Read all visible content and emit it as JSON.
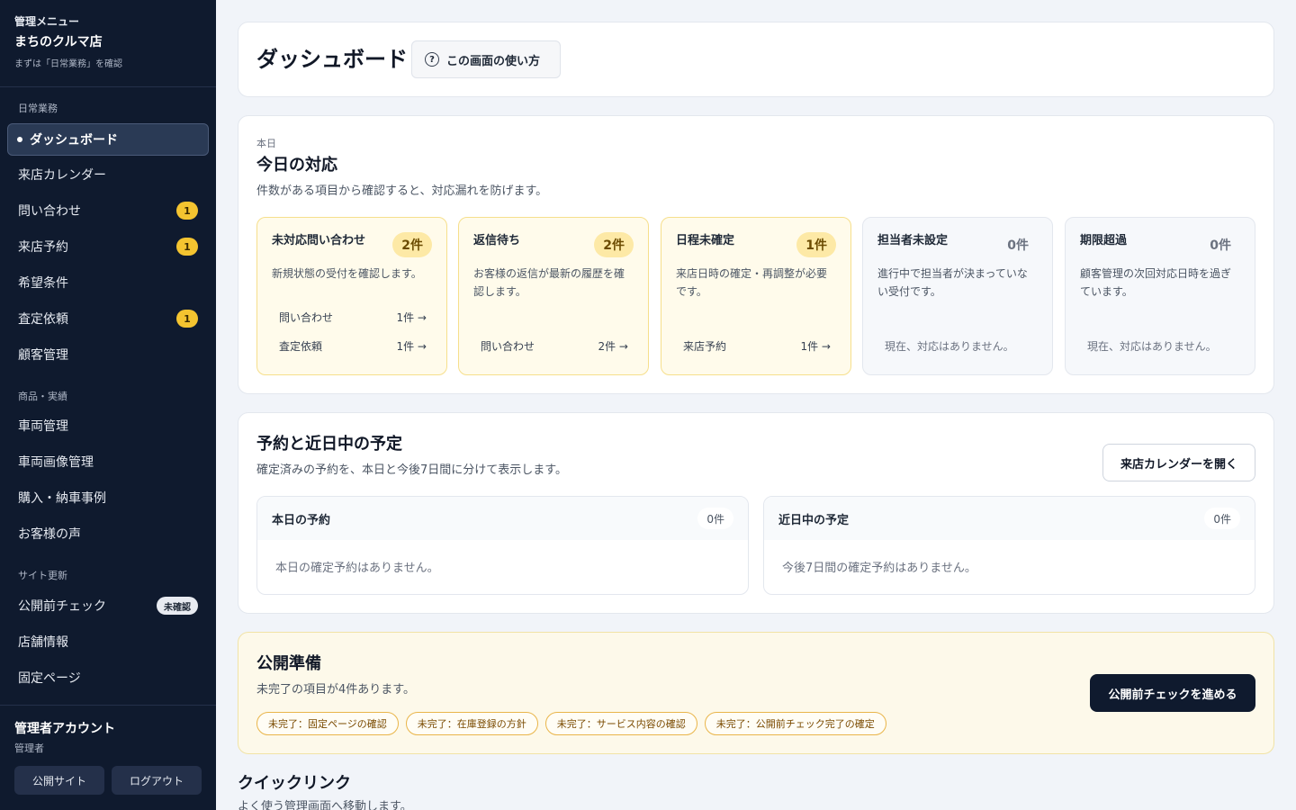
{
  "sidebar": {
    "kicker": "管理メニュー",
    "store_name": "まちのクルマ店",
    "hint": "まずは「日常業務」を確認",
    "sections": {
      "daily": "日常業務",
      "products": "商品・実績",
      "site": "サイト更新"
    },
    "items": {
      "dashboard": "ダッシュボード",
      "calendar": "来店カレンダー",
      "inquiries": "問い合わせ",
      "inquiries_badge": "1",
      "reservations": "来店予約",
      "reservations_badge": "1",
      "preferences": "希望条件",
      "appraisal": "査定依頼",
      "appraisal_badge": "1",
      "customers": "顧客管理",
      "vehicles": "車両管理",
      "vehicle_images": "車両画像管理",
      "cases": "購入・納車事例",
      "reviews": "お客様の声",
      "precheck": "公開前チェック",
      "precheck_badge": "未確認",
      "store_info": "店舗情報",
      "fixed_pages": "固定ページ"
    },
    "account": {
      "name": "管理者アカウント",
      "role": "管理者",
      "public_site": "公開サイト",
      "logout": "ログアウト"
    }
  },
  "header": {
    "title": "ダッシュボード",
    "help_icon": "question-circle-icon",
    "help_label": "この画面の使い方"
  },
  "today": {
    "kicker": "本日",
    "title": "今日の対応",
    "desc": "件数がある項目から確認すると、対応漏れを防げます。",
    "cards": [
      {
        "title": "未対応問い合わせ",
        "count": "2件",
        "desc": "新規状態の受付を確認します。",
        "rows": [
          {
            "label": "問い合わせ",
            "value": "1件 →"
          },
          {
            "label": "査定依頼",
            "value": "1件 →"
          }
        ]
      },
      {
        "title": "返信待ち",
        "count": "2件",
        "desc": "お客様の返信が最新の履歴を確認します。",
        "rows": [
          {
            "label": "問い合わせ",
            "value": "2件 →"
          }
        ]
      },
      {
        "title": "日程未確定",
        "count": "1件",
        "desc": "来店日時の確定・再調整が必要です。",
        "rows": [
          {
            "label": "来店予約",
            "value": "1件 →"
          }
        ]
      },
      {
        "title": "担当者未設定",
        "count": "0件",
        "desc": "進行中で担当者が決まっていない受付です。",
        "empty": "現在、対応はありません。"
      },
      {
        "title": "期限超過",
        "count": "0件",
        "desc": "顧客管理の次回対応日時を過ぎています。",
        "empty": "現在、対応はありません。"
      }
    ]
  },
  "schedule": {
    "title": "予約と近日中の予定",
    "desc": "確定済みの予約を、本日と今後7日間に分けて表示します。",
    "open_calendar": "来店カレンダーを開く",
    "today": {
      "title": "本日の予約",
      "count": "0件",
      "empty": "本日の確定予約はありません。"
    },
    "upcoming": {
      "title": "近日中の予定",
      "count": "0件",
      "empty": "今後7日間の確定予約はありません。"
    }
  },
  "publish": {
    "title": "公開準備",
    "desc": "未完了の項目が4件あります。",
    "button": "公開前チェックを進める",
    "chips": [
      "未完了：固定ページの確認",
      "未完了：在庫登録の方針",
      "未完了：サービス内容の確認",
      "未完了：公開前チェック完了の確定"
    ]
  },
  "quick": {
    "title": "クイックリンク",
    "desc": "よく使う管理画面へ移動します。"
  }
}
